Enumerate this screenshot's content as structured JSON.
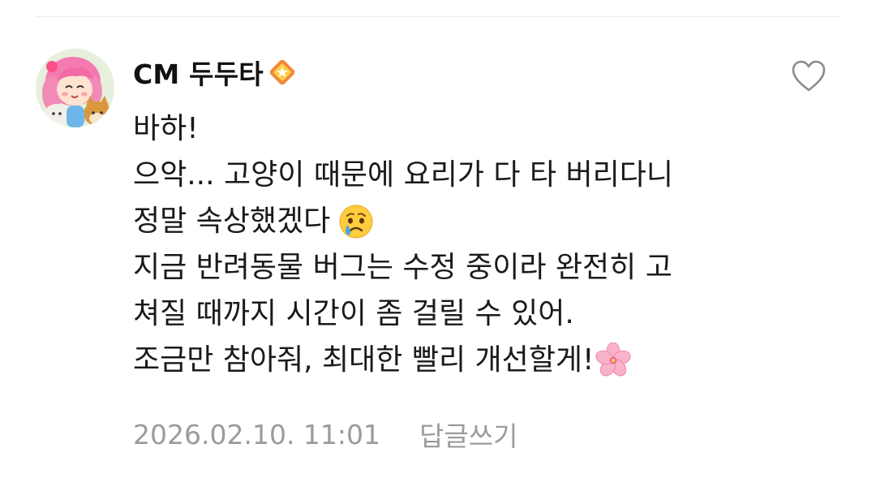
{
  "comment": {
    "author": "CM 두두타",
    "author_badge_icon": "gm-badge-icon",
    "avatar_icon": "character-avatar",
    "like_icon": "heart-outline-icon",
    "lines": [
      "바하!",
      "으악... 고양이 때문에 요리가 다 타 버리다니",
      "정말 속상했겠다",
      "지금 반려동물 버그는 수정 중이라 완전히 고",
      "쳐질 때까지 시간이 좀 걸릴 수 있어.",
      "조금만 참아줘, 최대한 빨리 개선할게!"
    ],
    "inline_emojis": [
      "crying-face-emoji",
      "cherry-blossom-emoji"
    ],
    "timestamp": "2026.02.10. 11:01",
    "reply_label": "답글쓰기"
  },
  "colors": {
    "text": "#1a1a1a",
    "meta": "#9b9b9b",
    "divider": "#ececec",
    "heart_outline": "#8a8a8a"
  }
}
